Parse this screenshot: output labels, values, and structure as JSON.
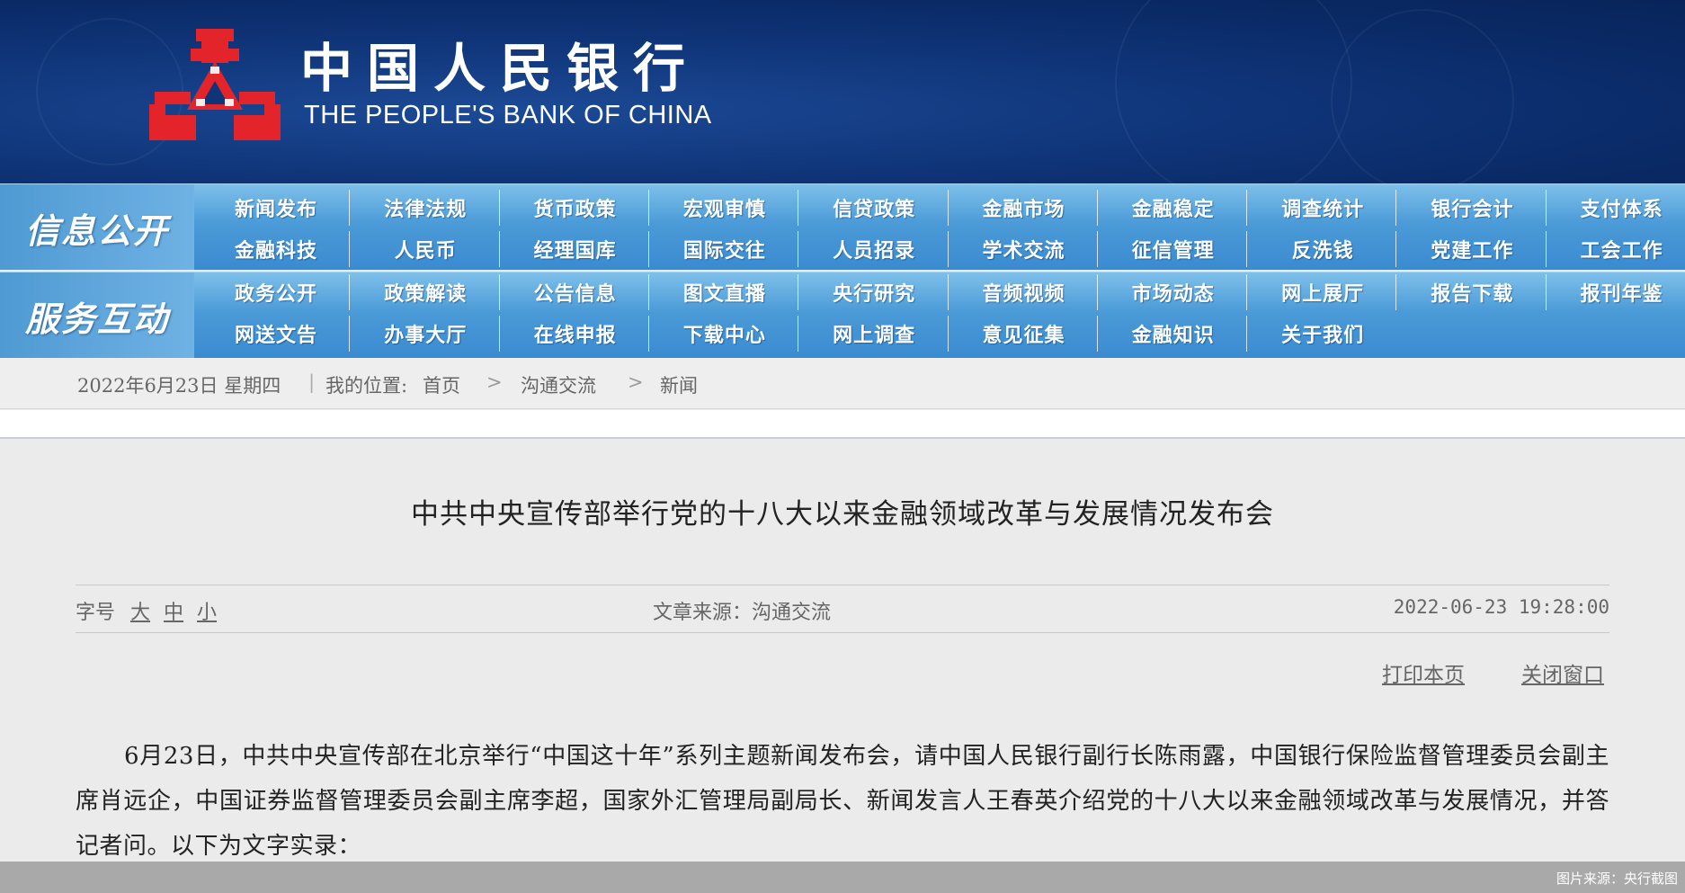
{
  "header": {
    "logo_cn": "中国人民银行",
    "logo_en": "THE PEOPLE'S BANK OF CHINA",
    "emblem_color": "#e3252b",
    "bg_color": "#0f3478"
  },
  "nav": {
    "group1_label": "信息公开",
    "group1_row1": [
      "新闻发布",
      "法律法规",
      "货币政策",
      "宏观审慎",
      "信贷政策",
      "金融市场",
      "金融稳定",
      "调查统计",
      "银行会计",
      "支付体系"
    ],
    "group1_row2": [
      "金融科技",
      "人民币",
      "经理国库",
      "国际交往",
      "人员招录",
      "学术交流",
      "征信管理",
      "反洗钱",
      "党建工作",
      "工会工作"
    ],
    "group2_label": "服务互动",
    "group2_row1": [
      "政务公开",
      "政策解读",
      "公告信息",
      "图文直播",
      "央行研究",
      "音频视频",
      "市场动态",
      "网上展厅",
      "报告下载",
      "报刊年鉴"
    ],
    "group2_row2": [
      "网送文告",
      "办事大厅",
      "在线申报",
      "下载中心",
      "网上调查",
      "意见征集",
      "金融知识",
      "关于我们"
    ]
  },
  "breadcrumb": {
    "date": "2022年6月23日  星期四",
    "location_label": "我的位置:",
    "home": "首页",
    "level1": "沟通交流",
    "level2": "新闻",
    "separator": ">"
  },
  "article": {
    "title": "中共中央宣传部举行党的十八大以来金融领域改革与发展情况发布会",
    "font_size_label": "字号",
    "font_large": "大",
    "font_medium": "中",
    "font_small": "小",
    "source": "文章来源：沟通交流",
    "datetime": "2022-06-23 19:28:00",
    "print_label": "打印本页",
    "close_label": "关闭窗口",
    "body": "6月23日，中共中央宣传部在北京举行“中国这十年”系列主题新闻发布会，请中国人民银行副行长陈雨露，中国银行保险监督管理委员会副主席肖远企，中国证券监督管理委员会副主席李超，国家外汇管理局副局长、新闻发言人王春英介绍党的十八大以来金融领域改革与发展情况，并答记者问。以下为文字实录："
  },
  "caption": "图片来源：央行截图"
}
